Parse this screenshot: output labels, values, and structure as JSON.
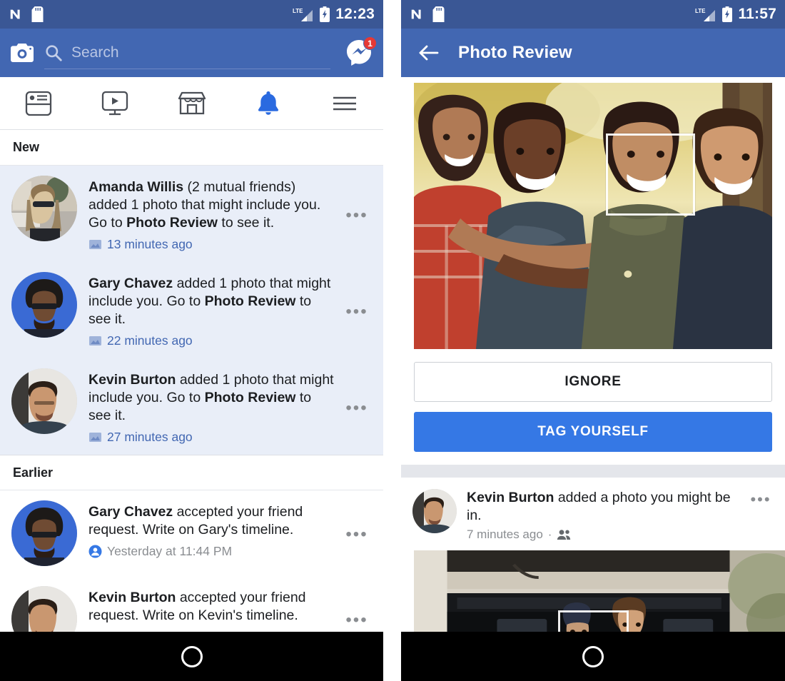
{
  "left_phone": {
    "status_bar": {
      "time": "12:23",
      "icons": [
        "android-n-icon",
        "sd-card-icon",
        "lte-icon",
        "signal-icon",
        "battery-charging-icon"
      ],
      "network_label": "LTE"
    },
    "header": {
      "camera_icon": "camera-icon",
      "search_icon": "search-icon",
      "search_placeholder": "Search",
      "search_value": "",
      "messenger_icon": "messenger-icon",
      "messenger_badge": "1"
    },
    "tabs": [
      {
        "name": "news-feed",
        "icon": "news-feed-icon",
        "active": false
      },
      {
        "name": "watch",
        "icon": "video-play-icon",
        "active": false
      },
      {
        "name": "marketplace",
        "icon": "store-icon",
        "active": false
      },
      {
        "name": "notifications",
        "icon": "bell-icon",
        "active": true
      },
      {
        "name": "menu",
        "icon": "hamburger-menu-icon",
        "active": false
      }
    ],
    "sections": [
      {
        "id": "new",
        "title": "New",
        "unread": true,
        "items": [
          {
            "avatar": "amanda-willis-avatar",
            "actor": "Amanda Willis",
            "suffix": " (2 mutual friends)",
            "body_1": " added 1 photo that might include you. Go to ",
            "link": "Photo Review",
            "body_2": " to see it.",
            "timestamp": "13 minutes ago",
            "meta_icon": "photo-icon",
            "menu": "•••"
          },
          {
            "avatar": "gary-chavez-avatar",
            "actor": "Gary Chavez",
            "suffix": "",
            "body_1": " added 1 photo that might include you. Go to ",
            "link": "Photo Review",
            "body_2": " to see it.",
            "timestamp": "22 minutes ago",
            "meta_icon": "photo-icon",
            "menu": "•••"
          },
          {
            "avatar": "kevin-burton-avatar",
            "actor": "Kevin Burton",
            "suffix": "",
            "body_1": " added 1 photo that might include you. Go to ",
            "link": "Photo Review",
            "body_2": " to see it.",
            "timestamp": "27 minutes ago",
            "meta_icon": "photo-icon",
            "menu": "•••"
          }
        ]
      },
      {
        "id": "earlier",
        "title": "Earlier",
        "unread": false,
        "items": [
          {
            "avatar": "gary-chavez-avatar",
            "actor": "Gary Chavez",
            "suffix": "",
            "body_1": " accepted your friend request. Write on Gary's timeline.",
            "link": "",
            "body_2": "",
            "timestamp": "Yesterday at 11:44 PM",
            "meta_icon": "friends-icon",
            "menu": "•••"
          },
          {
            "avatar": "kevin-burton-avatar",
            "actor": "Kevin Burton",
            "suffix": "",
            "body_1": " accepted your friend request. Write on Kevin's timeline.",
            "link": "",
            "body_2": "",
            "timestamp": "",
            "meta_icon": "",
            "menu": "•••"
          }
        ]
      }
    ]
  },
  "right_phone": {
    "status_bar": {
      "time": "11:57",
      "icons": [
        "android-n-icon",
        "sd-card-icon",
        "lte-icon",
        "signal-icon",
        "battery-charging-icon"
      ],
      "network_label": "LTE"
    },
    "header": {
      "back_icon": "back-arrow-icon",
      "title": "Photo Review"
    },
    "review_card": {
      "photo_alt": "four-friends-outdoors-photo",
      "face_tag_box": "face-tag-box",
      "ignore_label": "IGNORE",
      "tag_label": "TAG YOURSELF"
    },
    "next_post": {
      "avatar": "kevin-burton-avatar",
      "actor": "Kevin Burton",
      "body": " added a photo you might be in.",
      "timestamp": "7 minutes ago",
      "separator": "·",
      "audience_icon": "friends-audience-icon",
      "menu": "•••",
      "photo_alt": "couple-in-car-trunk-photo",
      "face_tag_box": "face-tag-box"
    }
  },
  "nav_bar": {
    "home_button": "home-circle-button"
  },
  "colors": {
    "fb_blue": "#4267b2",
    "status_blue": "#3a5795",
    "accent_blue": "#3578e5",
    "unread_bg": "#e9eef8",
    "page_bg": "#e4e6eb",
    "badge_red": "#e53935",
    "text_primary": "#1c1e21",
    "text_muted": "#8a8d91"
  }
}
